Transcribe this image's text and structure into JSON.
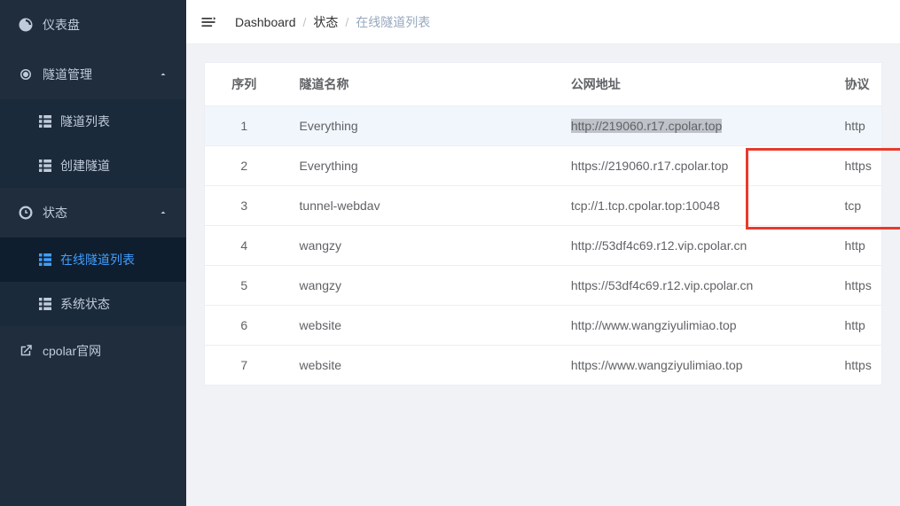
{
  "sidebar": {
    "dashboard": "仪表盘",
    "tunnel_mgmt": "隧道管理",
    "tunnel_list": "隧道列表",
    "create_tunnel": "创建隧道",
    "status": "状态",
    "online_tunnels": "在线隧道列表",
    "system_status": "系统状态",
    "cpolar_site": "cpolar官网"
  },
  "breadcrumb": {
    "root": "Dashboard",
    "mid": "状态",
    "current": "在线隧道列表"
  },
  "table": {
    "headers": {
      "index": "序列",
      "name": "隧道名称",
      "addr": "公网地址",
      "proto": "协议"
    },
    "rows": [
      {
        "index": "1",
        "name": "Everything",
        "addr": "http://219060.r17.cpolar.top",
        "proto": "http",
        "highlighted": true,
        "selected": true
      },
      {
        "index": "2",
        "name": "Everything",
        "addr": "https://219060.r17.cpolar.top",
        "proto": "https"
      },
      {
        "index": "3",
        "name": "tunnel-webdav",
        "addr": "tcp://1.tcp.cpolar.top:10048",
        "proto": "tcp"
      },
      {
        "index": "4",
        "name": "wangzy",
        "addr": "http://53df4c69.r12.vip.cpolar.cn",
        "proto": "http"
      },
      {
        "index": "5",
        "name": "wangzy",
        "addr": "https://53df4c69.r12.vip.cpolar.cn",
        "proto": "https"
      },
      {
        "index": "6",
        "name": "website",
        "addr": "http://www.wangziyulimiao.top",
        "proto": "http"
      },
      {
        "index": "7",
        "name": "website",
        "addr": "https://www.wangziyulimiao.top",
        "proto": "https"
      }
    ]
  }
}
